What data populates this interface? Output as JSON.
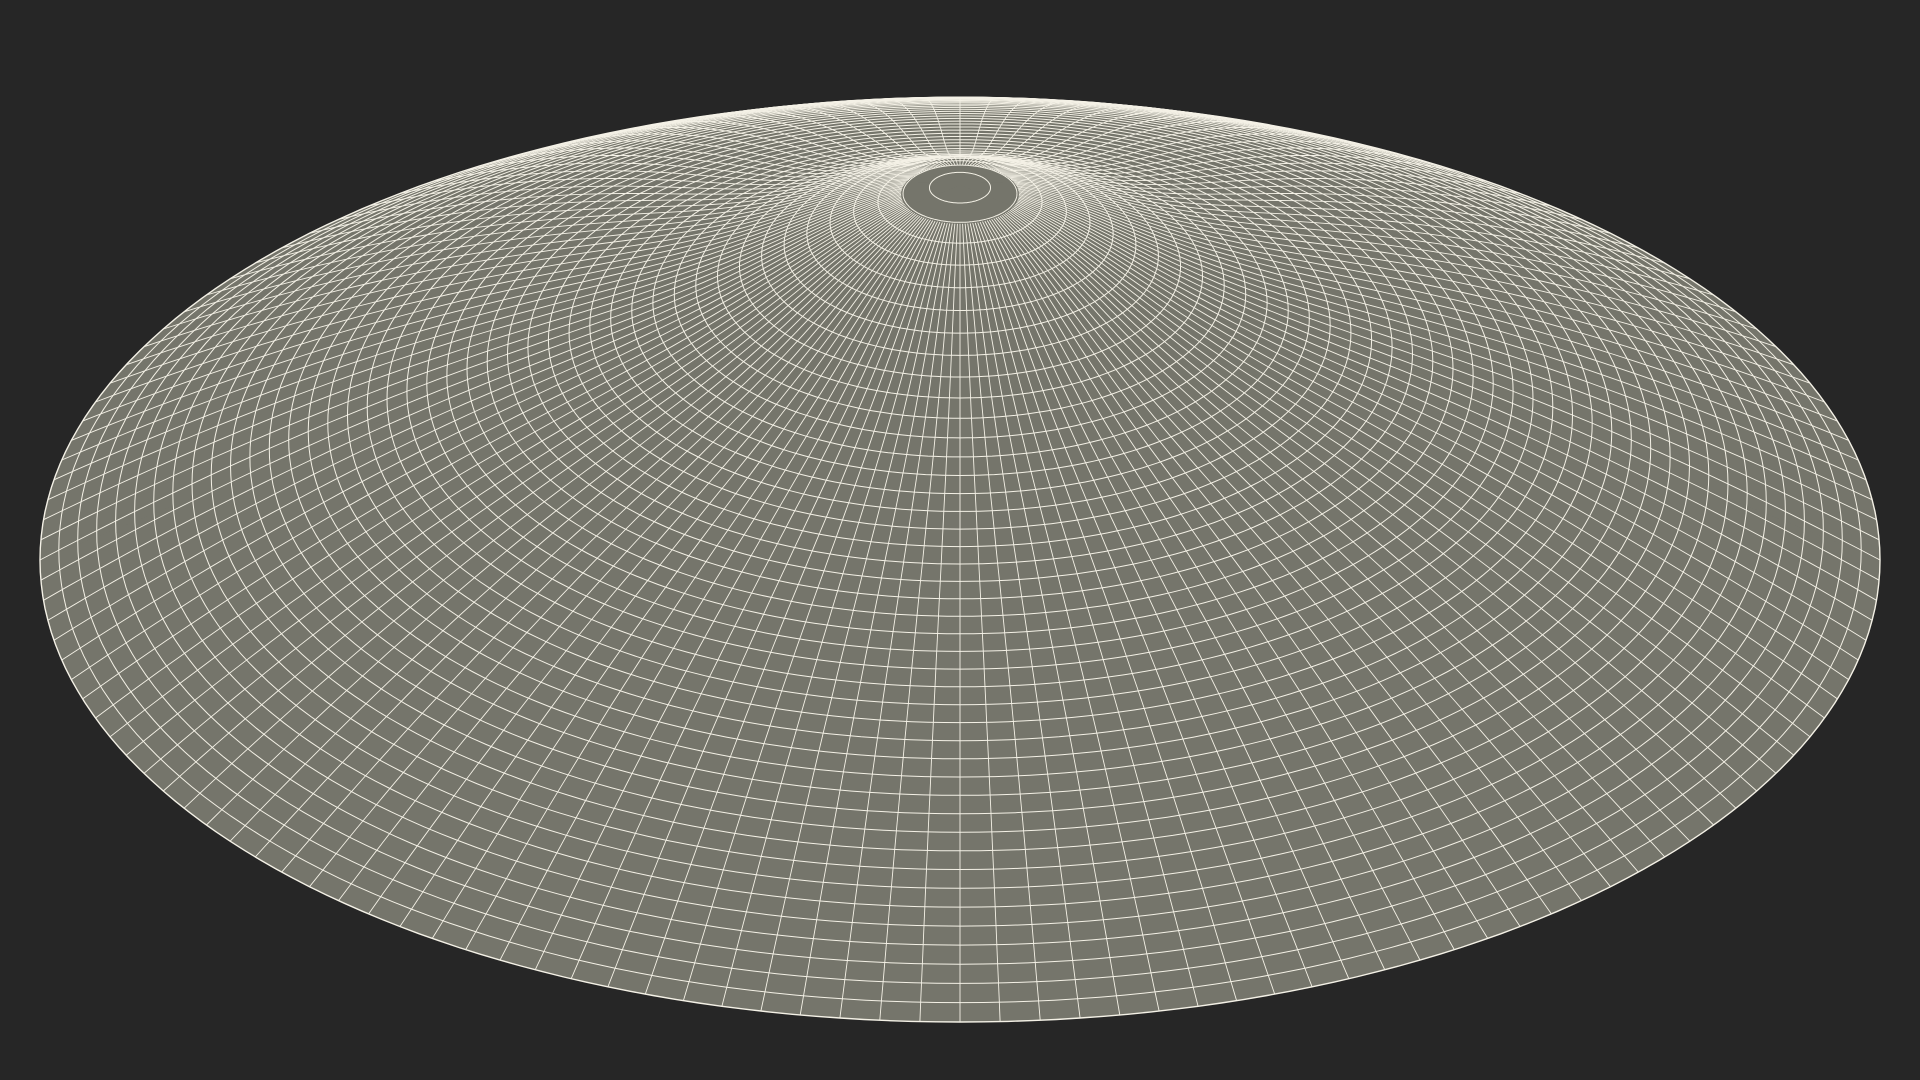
{
  "scene": {
    "background_color": "#262626",
    "surface_color": "#75756b",
    "wire_color": "#f4f1e6",
    "object": "wireframe-dome"
  }
}
